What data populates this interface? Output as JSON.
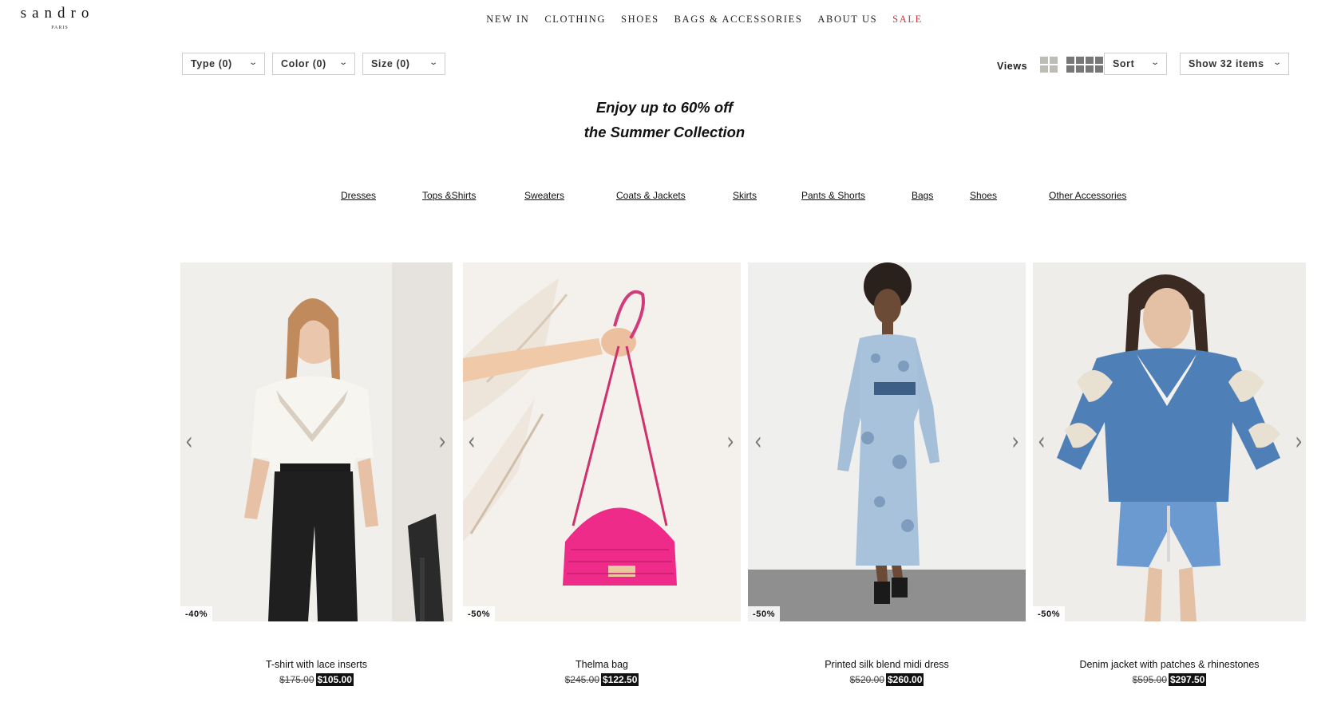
{
  "brand": {
    "name": "sandro",
    "sub": "PARIS"
  },
  "nav": {
    "items": [
      "NEW IN",
      "CLOTHING",
      "SHOES",
      "BAGS & ACCESSORIES",
      "ABOUT US"
    ],
    "sale": "SALE",
    "sale_color": "#d23a3a"
  },
  "filters": {
    "type": "Type (0)",
    "color": "Color (0)",
    "size": "Size (0)",
    "views_label": "Views",
    "sort": "Sort",
    "show": "Show 32 items"
  },
  "promo": {
    "line1": "Enjoy up to 60% off",
    "line2": "the Summer Collection"
  },
  "categories": [
    "Dresses",
    "Tops &Shirts",
    "Sweaters",
    "Coats & Jackets",
    "Skirts",
    "Pants & Shorts",
    "Bags",
    "Shoes",
    "Other Accessories"
  ],
  "products": [
    {
      "name": "T-shirt with lace inserts",
      "discount": "-40%",
      "old_price": "$175.00",
      "price": "$105.00",
      "image": "woman-white-lace-tshirt-black-jeans"
    },
    {
      "name": "Thelma bag",
      "discount": "-50%",
      "old_price": "$245.00",
      "price": "$122.50",
      "image": "hand-holding-pink-quilted-bag"
    },
    {
      "name": "Printed silk blend midi dress",
      "discount": "-50%",
      "old_price": "$520.00",
      "price": "$260.00",
      "image": "woman-blue-printed-midi-dress"
    },
    {
      "name": "Denim jacket with patches & rhinestones",
      "discount": "-50%",
      "old_price": "$595.00",
      "price": "$297.50",
      "image": "woman-denim-jacket-shorts"
    }
  ],
  "icons": {
    "grid_small": "grid-4-icon",
    "grid_large": "grid-8-icon",
    "chevron": "chevron-down-icon",
    "prev": "chevron-left-icon",
    "next": "chevron-right-icon"
  }
}
